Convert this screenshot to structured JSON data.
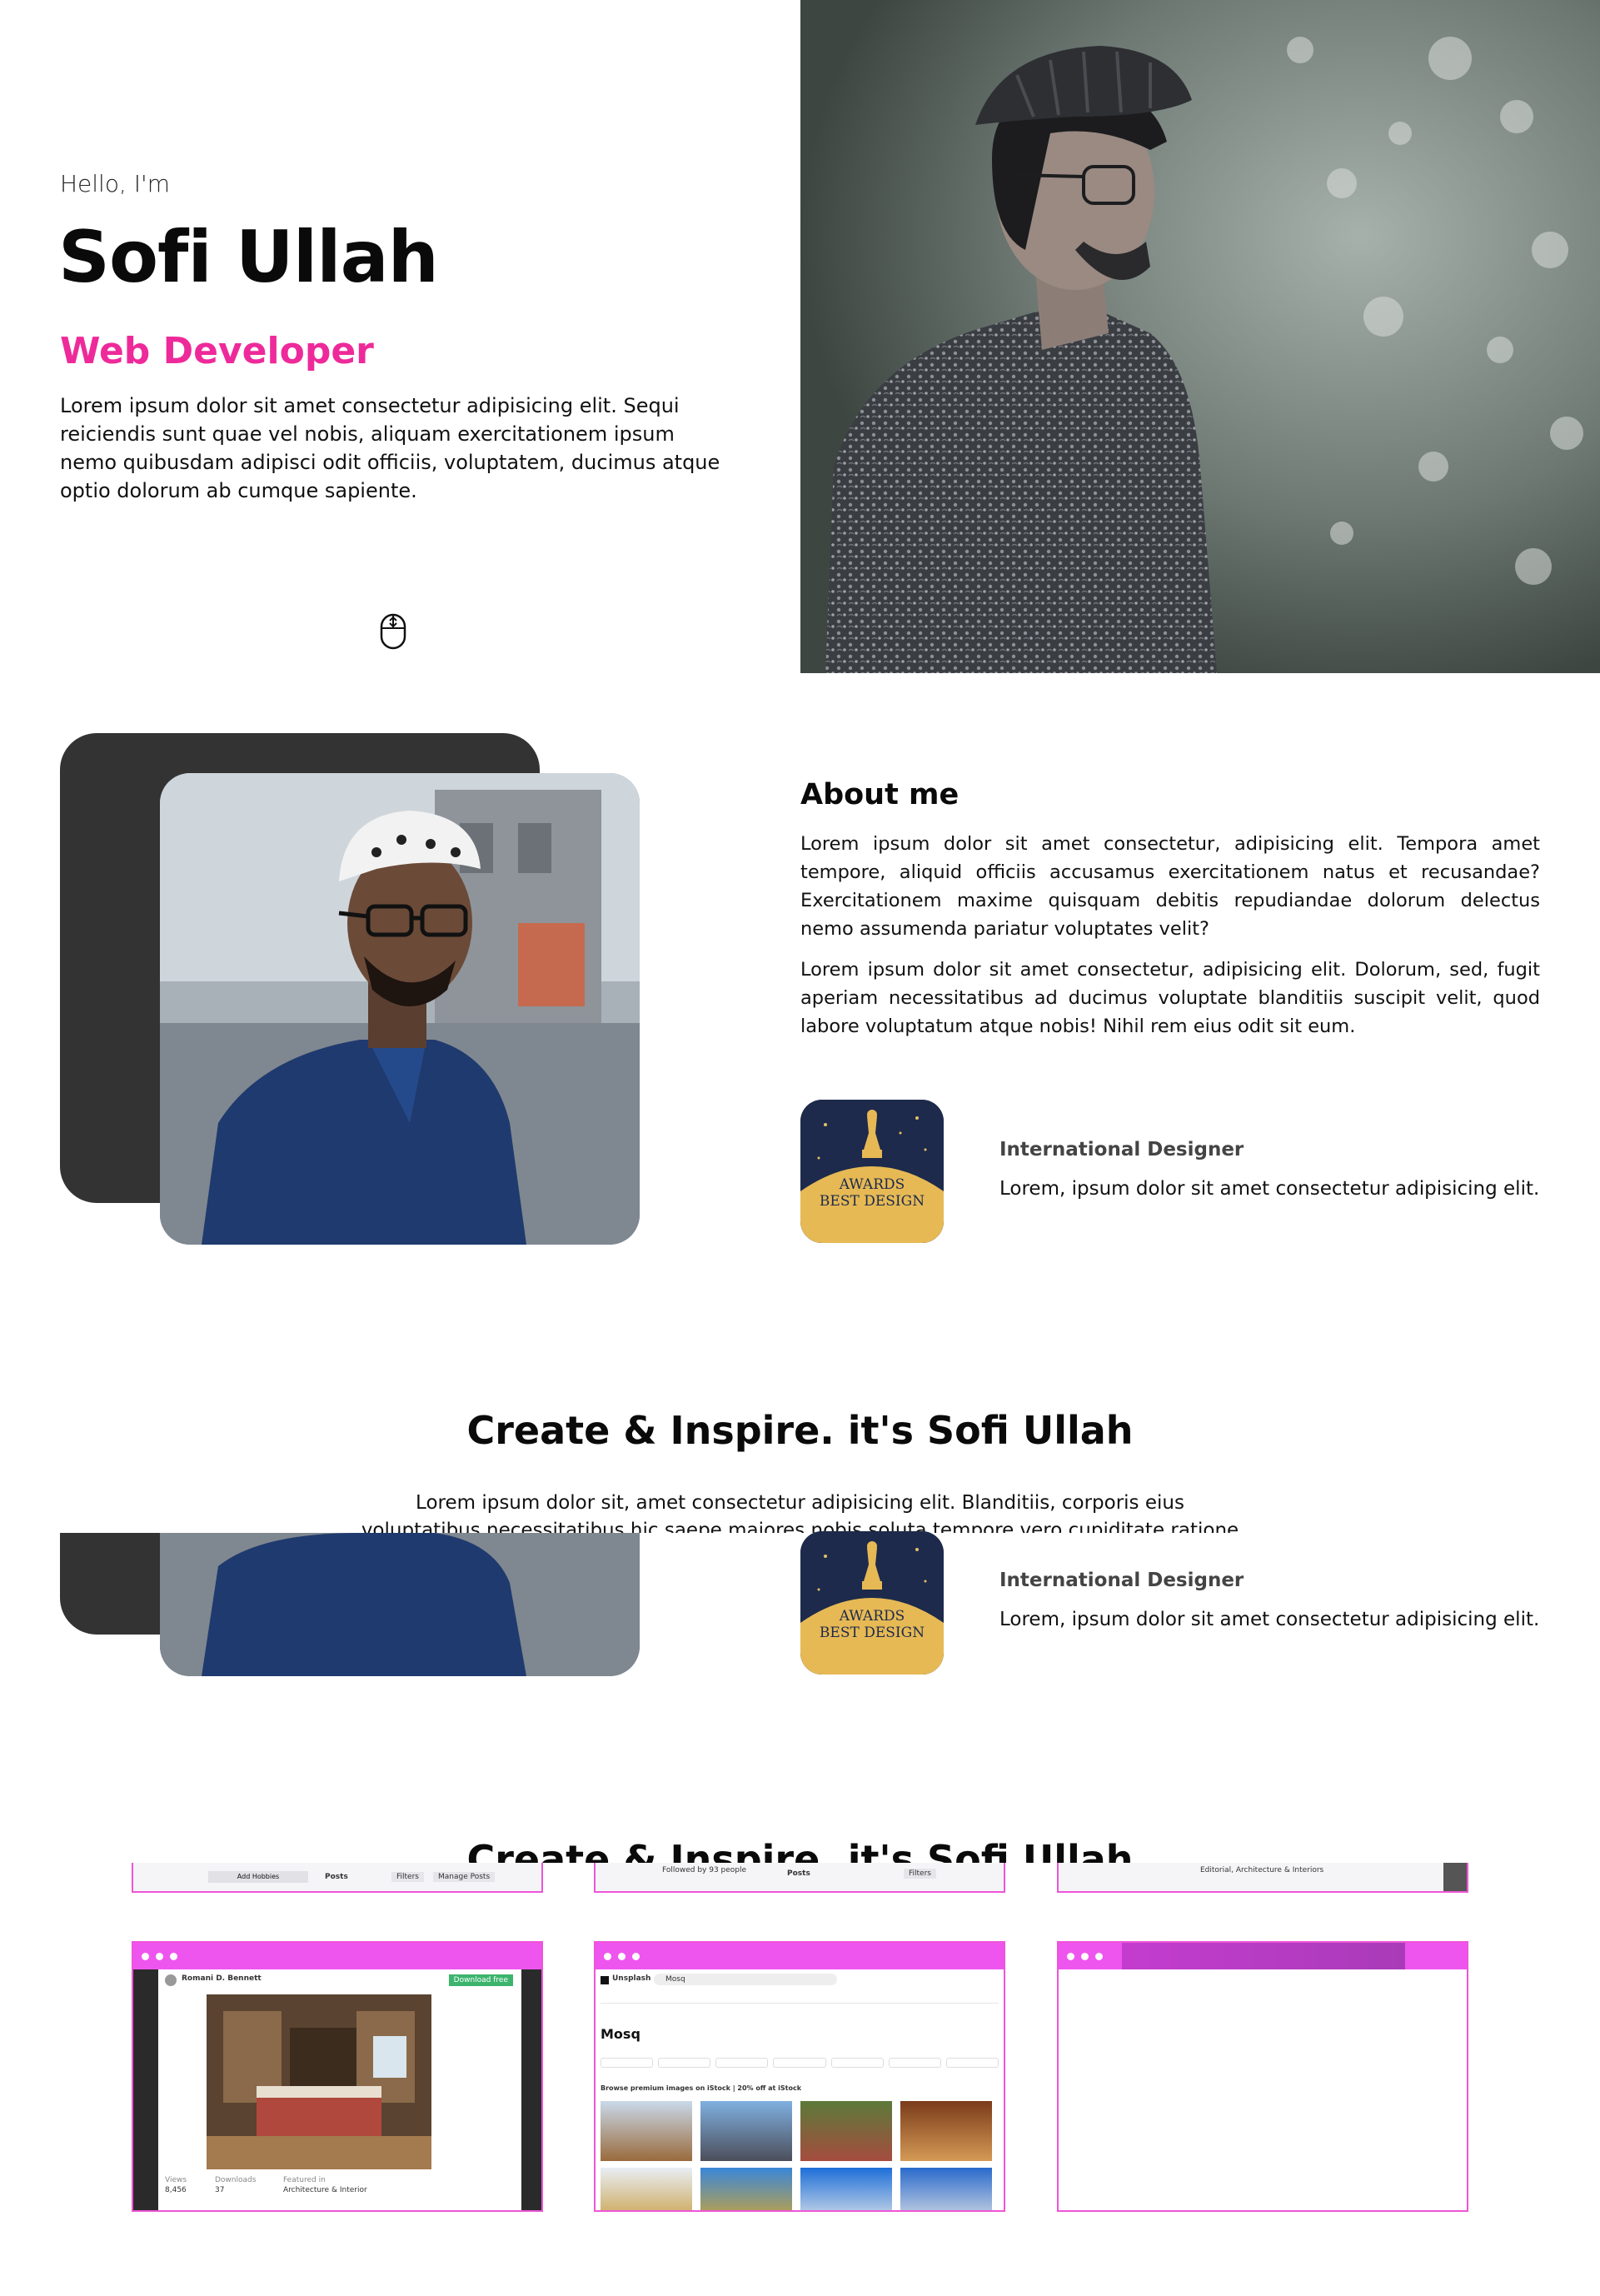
{
  "hero": {
    "greeting": "Hello, I'm",
    "name": "Sofi Ullah",
    "role": "Web Developer",
    "description": "Lorem ipsum dolor sit amet consectetur adipisicing elit. Sequi reiciendis sunt quae vel nobis, aliquam exercitationem ipsum nemo quibusdam adipisci odit officiis, voluptatem, ducimus atque optio dolorum ab cumque sapiente."
  },
  "about": {
    "title": "About me",
    "paragraph1": "Lorem ipsum dolor sit amet consectetur, adipisicing elit. Tempora amet tempore, aliquid officiis accusamus exercitationem natus et recusandae? Exercitationem maxime quisquam debitis repudiandae dolorum delectus nemo assumenda pariatur voluptates velit?",
    "paragraph2": "Lorem ipsum dolor sit amet consectetur, adipisicing elit. Dolorum, sed, fugit aperiam necessitatibus ad ducimus voluptate blanditiis suscipit velit, quod labore voluptatum atque nobis! Nihil rem eius odit sit eum.",
    "award": {
      "badge_line1": "AWARDS",
      "badge_line2": "BEST DESIGN",
      "title": "International Designer",
      "description": "Lorem, ipsum dolor sit amet consectetur adipisicing elit."
    }
  },
  "create": {
    "title": "Create & Inspire. it's Sofi Ullah",
    "description": "Lorem ipsum dolor sit, amet consectetur adipisicing elit. Blanditiis, corporis eius voluptatibus necessitatibus hic saepe maiores nobis soluta tempore vero cupiditate ratione reiciendis"
  },
  "projects": {
    "card1": {
      "user": "Romani D. Bennett",
      "button": "Download free",
      "stat1_label": "Views",
      "stat1_value": "8,456",
      "stat2_label": "Downloads",
      "stat2_value": "37",
      "stat3_label": "Featured in",
      "stat3_value": "Architecture & Interior",
      "top_left": "Add Hobbies",
      "top_mid": "Posts",
      "top_btn1": "Filters",
      "top_btn2": "Manage Posts"
    },
    "card2": {
      "brand": "Unsplash",
      "search": "Mosq",
      "heading": "Mosq",
      "banner": "Browse premium images on iStock | 20% off at iStock",
      "top_label": "Posts",
      "top_btn": "Filters",
      "top_line": "Followed by 93 people"
    },
    "card3": {
      "top_label": "Editorial, Architecture & Interiors"
    }
  },
  "colors": {
    "accent": "#ee2a9a",
    "card_border": "#ee55d8",
    "dark_card": "#333333"
  },
  "icons": {
    "scroll": "mouse-scroll-icon",
    "dots": "window-dots-icon"
  }
}
